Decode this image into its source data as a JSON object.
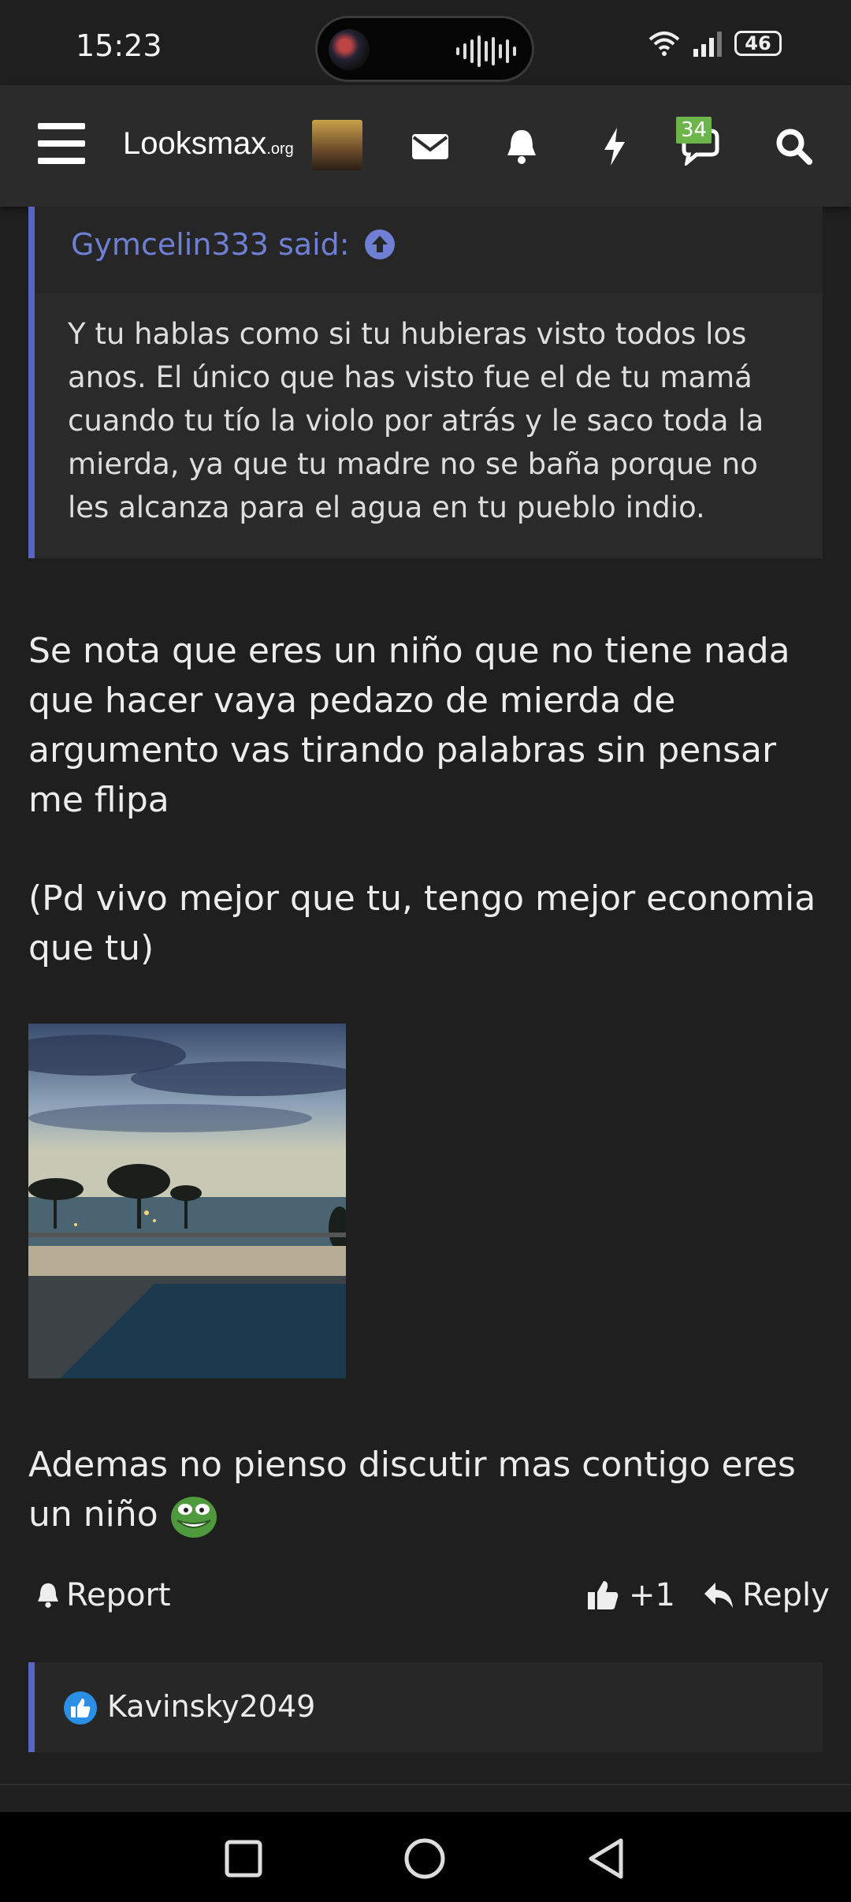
{
  "status_bar": {
    "time": "15:23",
    "battery": "46",
    "icons": [
      "wifi-icon",
      "signal-icon",
      "battery-icon"
    ]
  },
  "topbar": {
    "logo_main": "Looksmax",
    "logo_suffix": ".org",
    "chat_badge": "34",
    "icons": [
      "menu-icon",
      "mail-icon",
      "bell-icon",
      "lightning-icon",
      "chat-icon",
      "search-icon"
    ]
  },
  "quote": {
    "author": "Gymcelin333 said:",
    "body": "Y tu hablas como si tu hubieras visto todos los anos. El único que has visto fue el de tu mamá cuando tu tío la violo por atrás y le saco toda la mierda, ya que tu madre no se baña porque no les alcanza para el agua en tu pueblo indio."
  },
  "post": {
    "paragraph1": "Se nota que eres un niño que no tiene nada que hacer vaya pedazo de mierda de argumento vas tirando palabras sin pensar me flipa",
    "paragraph2": "(Pd vivo mejor que tu, tengo mejor economia que tu)",
    "paragraph3": "Ademas no pienso discutir mas contigo eres un niño"
  },
  "actions": {
    "report": "Report",
    "like_count": "+1",
    "reply": "Reply"
  },
  "reactions": {
    "user": "Kavinsky2049"
  },
  "colors": {
    "accent": "#5865c5",
    "quote_author": "#6f7fd4",
    "badge": "#6cb54a",
    "background": "#1f1f1f"
  }
}
